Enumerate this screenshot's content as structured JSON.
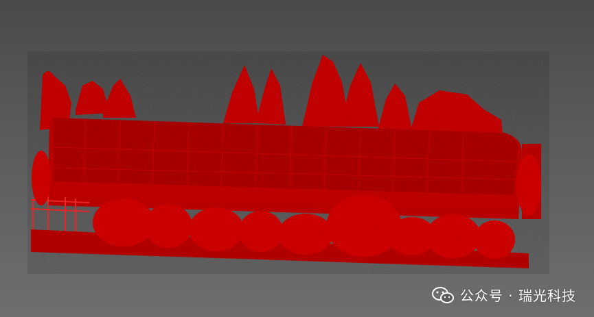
{
  "scene": {
    "subject": "point-cloud-greenhouse",
    "point_color": "#e00000",
    "background_top": "#4a4a4a",
    "background_bottom": "#6e6e6e"
  },
  "watermark": {
    "text": "公众号 · 瑞光科技",
    "icon": "wechat-icon"
  }
}
